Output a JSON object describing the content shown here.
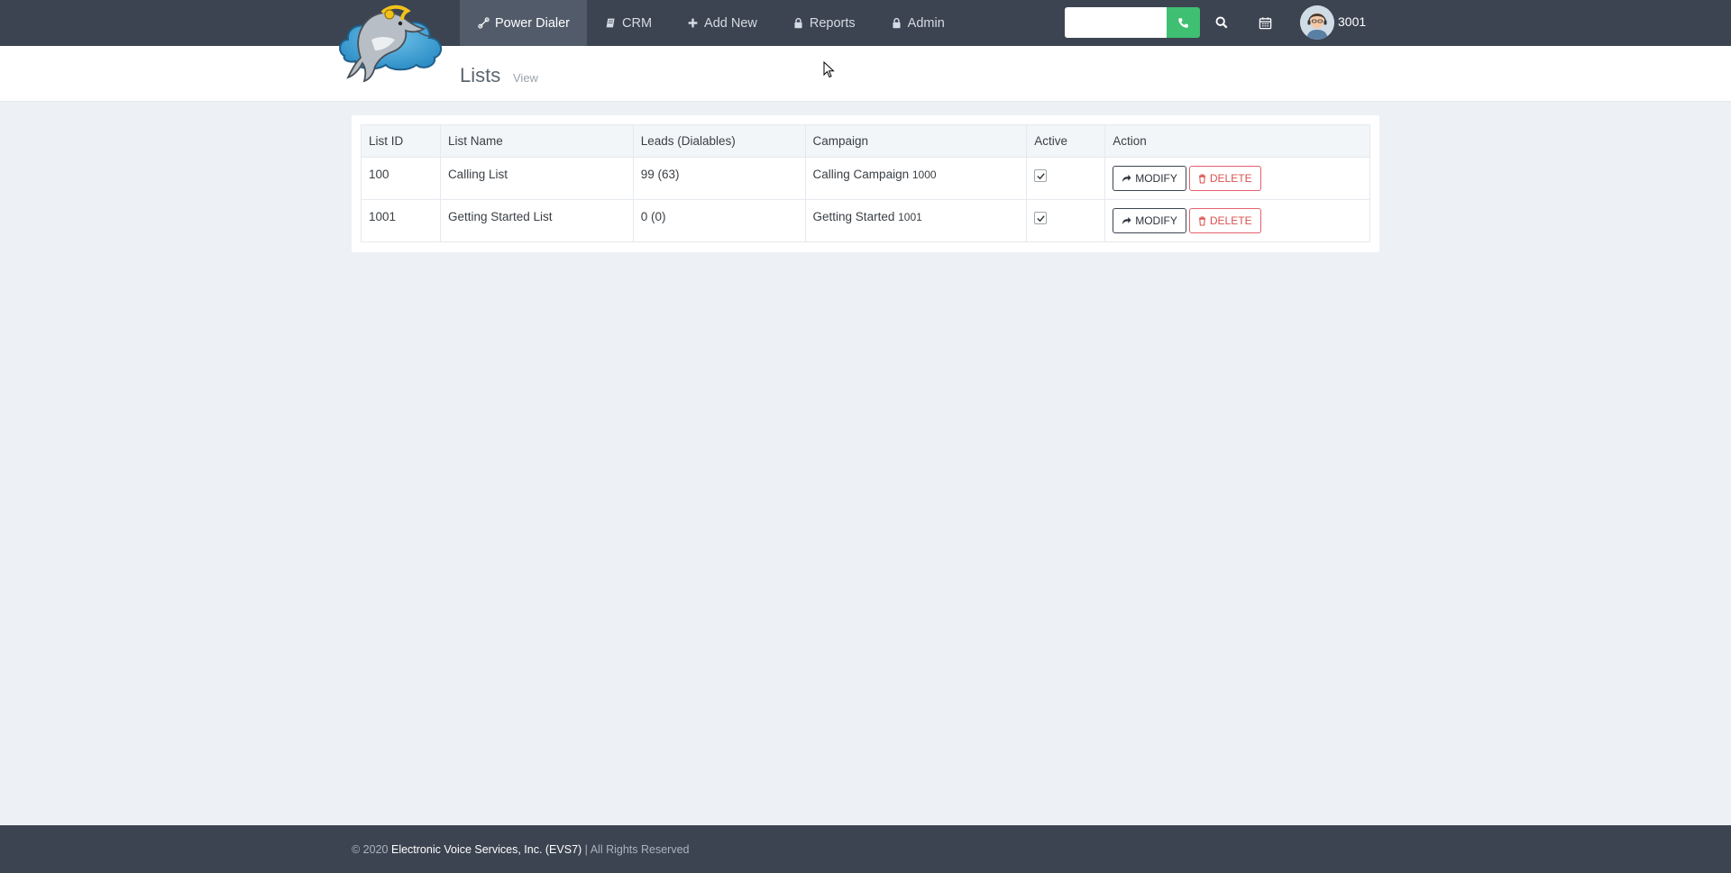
{
  "nav": {
    "items": [
      {
        "label": "Power Dialer",
        "icon": "phone-handset-icon",
        "active": true
      },
      {
        "label": "CRM",
        "icon": "book-icon",
        "active": false
      },
      {
        "label": "Add New",
        "icon": "plus-icon",
        "active": false
      },
      {
        "label": "Reports",
        "icon": "lock-icon",
        "active": false
      },
      {
        "label": "Admin",
        "icon": "lock-icon",
        "active": false
      }
    ],
    "dial_value": "",
    "user_ext": "3001"
  },
  "page": {
    "title": "Lists",
    "subtitle": "View"
  },
  "table": {
    "headers": [
      "List ID",
      "List Name",
      "Leads (Dialables)",
      "Campaign",
      "Active",
      "Action"
    ],
    "rows": [
      {
        "list_id": "100",
        "list_name": "Calling List",
        "leads": "99 (63)",
        "campaign_name": "Calling Campaign",
        "campaign_id": "1000",
        "active": true
      },
      {
        "list_id": "1001",
        "list_name": "Getting Started List",
        "leads": "0 (0)",
        "campaign_name": "Getting Started",
        "campaign_id": "1001",
        "active": true
      }
    ],
    "modify_label": "MODIFY",
    "delete_label": "DELETE"
  },
  "footer": {
    "prefix": "© 2020",
    "company": "Electronic Voice Services, Inc. (EVS7)",
    "suffix": "| All Rights Reserved"
  },
  "colors": {
    "topbar": "#3c4451",
    "active_nav": "#525b69",
    "dial_button": "#3fbf71",
    "delete": "#d9534f",
    "background": "#edf1f5"
  }
}
